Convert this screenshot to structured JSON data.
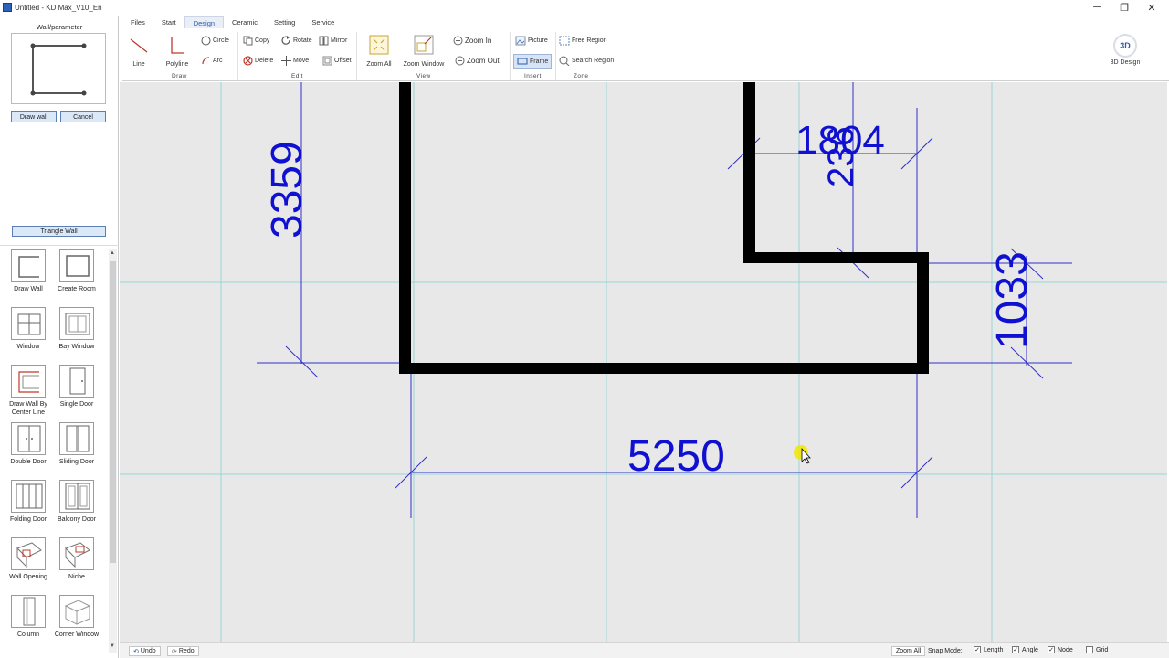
{
  "window": {
    "title": "Untitled - KD Max_V10_En",
    "minimize": "─",
    "restore": "❐",
    "close": "✕"
  },
  "menu": {
    "tabs": [
      "Files",
      "Start",
      "Design",
      "Ceramic",
      "Setting",
      "Service"
    ],
    "active": "Design"
  },
  "ribbon": {
    "draw": {
      "group": "Draw",
      "line": "Line",
      "polyline": "Polyline",
      "circle": "Circle",
      "arc": "Arc"
    },
    "edit": {
      "group": "Edit",
      "copy": "Copy",
      "rotate": "Rotate",
      "mirror": "Mirror",
      "delete": "Delete",
      "move": "Move",
      "offset": "Offset"
    },
    "view": {
      "group": "View",
      "zoom_all": "Zoom All",
      "zoom_window": "Zoom Window",
      "zoom_in": "Zoom In",
      "zoom_out": "Zoom Out"
    },
    "insert": {
      "group": "Insert",
      "picture": "Picture",
      "frame": "Frame"
    },
    "zone": {
      "group": "Zone",
      "free_region": "Free Region",
      "search_region": "Search Region"
    },
    "design3d": {
      "label": "3D Design",
      "badge": "3D"
    }
  },
  "leftpanel": {
    "title": "Wall/parameter",
    "draw_wall": "Draw wall",
    "cancel": "Cancel",
    "triangle_wall": "Triangle Wall",
    "tools": [
      {
        "name": "draw-wall",
        "label": "Draw Wall"
      },
      {
        "name": "create-room",
        "label": "Create Room"
      },
      {
        "name": "window",
        "label": "Window"
      },
      {
        "name": "bay-window",
        "label": "Bay Window"
      },
      {
        "name": "draw-wall-by-center-line",
        "label": "Draw Wall By Center Line"
      },
      {
        "name": "single-door",
        "label": "Single Door"
      },
      {
        "name": "double-door",
        "label": "Double Door"
      },
      {
        "name": "sliding-door",
        "label": "Sliding Door"
      },
      {
        "name": "folding-door",
        "label": "Folding Door"
      },
      {
        "name": "balcony-door",
        "label": "Balcony Door"
      },
      {
        "name": "wall-opening",
        "label": "Wall Opening"
      },
      {
        "name": "niche",
        "label": "Niche"
      },
      {
        "name": "column",
        "label": "Column"
      },
      {
        "name": "corner-window",
        "label": "Corner Window"
      }
    ]
  },
  "dimensions": {
    "left": "3359",
    "bottom": "5250",
    "right": "1033",
    "top_a": "1804",
    "top_b": "236"
  },
  "colors": {
    "dimension": "#1010d0",
    "wall": "#000000",
    "grid": "#9cd6d6",
    "canvas": "#e8e8e8",
    "cursor_highlight": "#f2e600"
  },
  "status": {
    "undo": "Undo",
    "redo": "Redo",
    "zoom_all": "Zoom All",
    "snap_mode": "Snap Mode:",
    "length": "Length",
    "angle": "Angle",
    "node": "Node",
    "grid": "Grid",
    "length_checked": true,
    "angle_checked": true,
    "node_checked": true,
    "grid_checked": false
  }
}
